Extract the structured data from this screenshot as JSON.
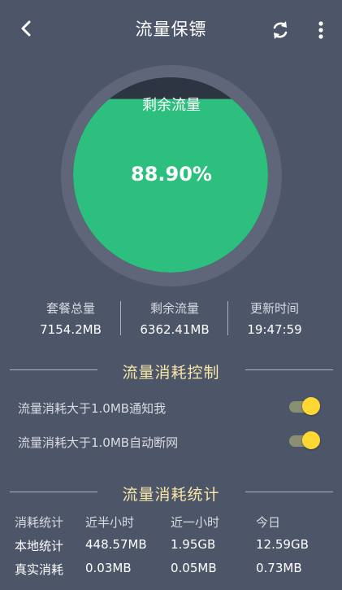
{
  "header": {
    "title": "流量保镖"
  },
  "icons": {
    "back": "back-arrow-icon",
    "refresh": "refresh-icon",
    "more": "more-vertical-icon"
  },
  "gauge": {
    "label": "剩余流量",
    "percent_text": "88.90%",
    "fraction": 0.889
  },
  "stats": [
    {
      "label": "套餐总量",
      "value": "7154.2MB"
    },
    {
      "label": "剩余流量",
      "value": "6362.41MB"
    },
    {
      "label": "更新时间",
      "value": "19:47:59"
    }
  ],
  "control": {
    "title": "流量消耗控制",
    "rows": [
      {
        "label": "流量消耗大于1.0MB通知我",
        "on": true
      },
      {
        "label": "流量消耗大于1.0MB自动断网",
        "on": true
      }
    ]
  },
  "statistics": {
    "title": "流量消耗统计",
    "headers": [
      "消耗统计",
      "近半小时",
      "近一小时",
      "今日"
    ],
    "rows": [
      {
        "label": "本地统计",
        "values": [
          "448.57MB",
          "1.95GB",
          "12.59GB"
        ]
      },
      {
        "label": "真实消耗",
        "values": [
          "0.03MB",
          "0.05MB",
          "0.73MB"
        ]
      }
    ]
  },
  "colors": {
    "background": "#4d5568",
    "fill": "#2dbf7e",
    "accent": "#f6e7a8",
    "toggle": "#fdd835"
  }
}
